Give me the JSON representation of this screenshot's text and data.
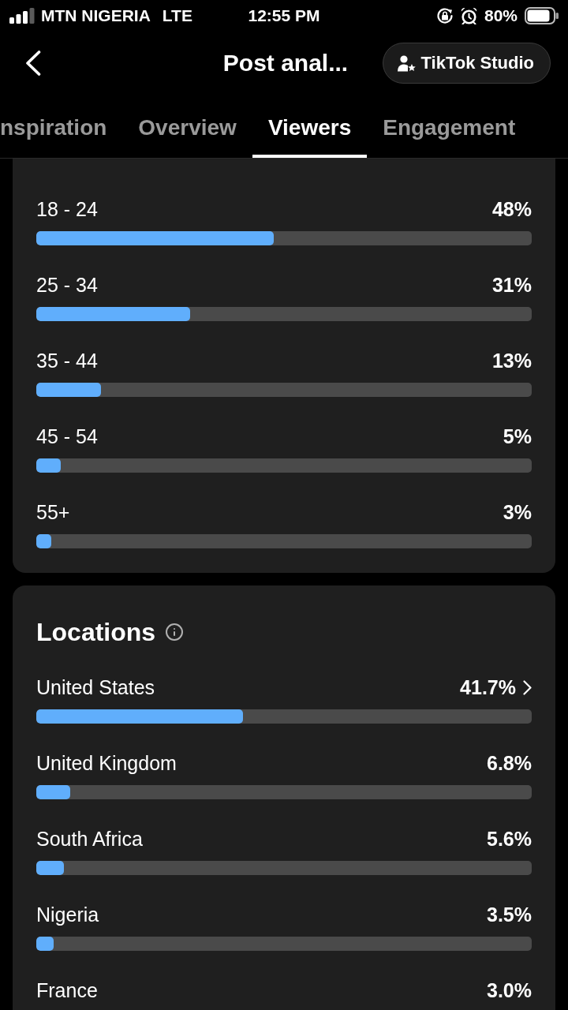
{
  "status_bar": {
    "carrier": "MTN NIGERIA",
    "network": "LTE",
    "time": "12:55 PM",
    "battery": "80%"
  },
  "header": {
    "title": "Post anal...",
    "studio_button": "TikTok Studio"
  },
  "tabs": [
    {
      "label": "nspiration",
      "selected": false
    },
    {
      "label": "Overview",
      "selected": false
    },
    {
      "label": "Viewers",
      "selected": true
    },
    {
      "label": "Engagement",
      "selected": false
    }
  ],
  "age": {
    "rows": [
      {
        "label": "18 - 24",
        "value": "48%",
        "level": 0.48
      },
      {
        "label": "25 - 34",
        "value": "31%",
        "level": 0.31
      },
      {
        "label": "35 - 44",
        "value": "13%",
        "level": 0.13
      },
      {
        "label": "45 - 54",
        "value": "5%",
        "level": 0.05
      },
      {
        "label": "55+",
        "value": "3%",
        "level": 0.03
      }
    ]
  },
  "locations": {
    "title": "Locations",
    "rows": [
      {
        "label": "United States",
        "value": "41.7%",
        "level": 0.417,
        "has_details": true
      },
      {
        "label": "United Kingdom",
        "value": "6.8%",
        "level": 0.068,
        "has_details": false
      },
      {
        "label": "South Africa",
        "value": "5.6%",
        "level": 0.056,
        "has_details": false
      },
      {
        "label": "Nigeria",
        "value": "3.5%",
        "level": 0.035,
        "has_details": false
      },
      {
        "label": "France",
        "value": "3.0%",
        "has_details": false
      }
    ]
  }
}
